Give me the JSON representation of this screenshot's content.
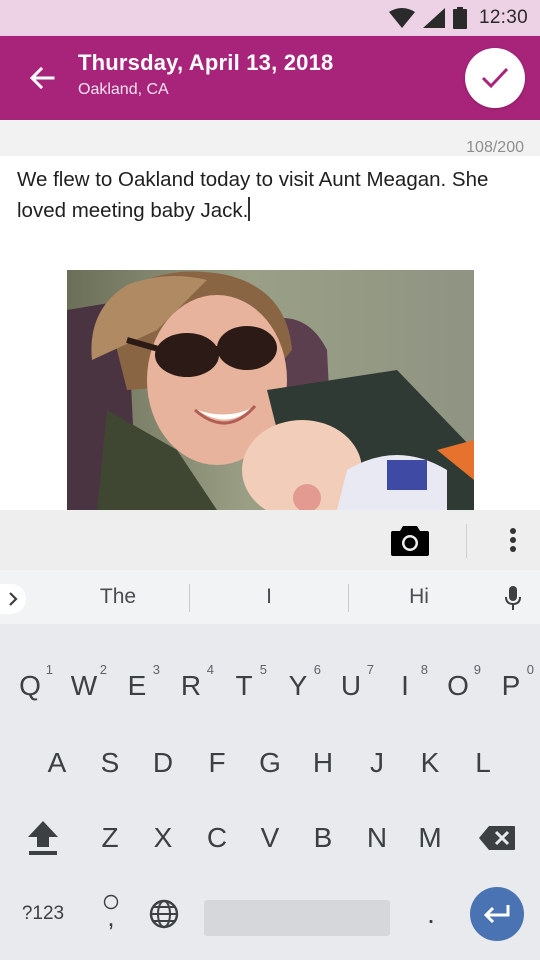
{
  "status_bar": {
    "time": "12:30",
    "icons": [
      "wifi-icon",
      "cell-signal-icon",
      "battery-icon"
    ]
  },
  "app_bar": {
    "title": "Thursday, April 13, 2018",
    "subtitle": "Oakland, CA",
    "back_icon": "arrow-left-icon",
    "done_icon": "checkmark-icon"
  },
  "editor": {
    "char_count": "108/200",
    "text": "We flew to Oakland today to visit Aunt Meagan.  She loved meeting baby Jack.",
    "photo": "woman-in-sunglasses-holding-baby-photo"
  },
  "keyboard_toolbar": {
    "camera_icon": "camera-icon",
    "more_icon": "more-vert-icon"
  },
  "keyboard": {
    "suggestions": [
      "The",
      "I",
      "Hi"
    ],
    "row1": [
      {
        "label": "Q",
        "hint": "1"
      },
      {
        "label": "W",
        "hint": "2"
      },
      {
        "label": "E",
        "hint": "3"
      },
      {
        "label": "R",
        "hint": "4"
      },
      {
        "label": "T",
        "hint": "5"
      },
      {
        "label": "Y",
        "hint": "6"
      },
      {
        "label": "U",
        "hint": "7"
      },
      {
        "label": "I",
        "hint": "8"
      },
      {
        "label": "O",
        "hint": "9"
      },
      {
        "label": "P",
        "hint": "0"
      }
    ],
    "row2": [
      "A",
      "S",
      "D",
      "F",
      "G",
      "H",
      "J",
      "K",
      "L"
    ],
    "row3": [
      "Z",
      "X",
      "C",
      "V",
      "B",
      "N",
      "M"
    ],
    "symbols_label": "?123",
    "comma_label": ",",
    "period_label": ".",
    "colors": {
      "accent": "#a8247a",
      "enter": "#4a73b3",
      "status_bar": "#edd2e6"
    }
  }
}
